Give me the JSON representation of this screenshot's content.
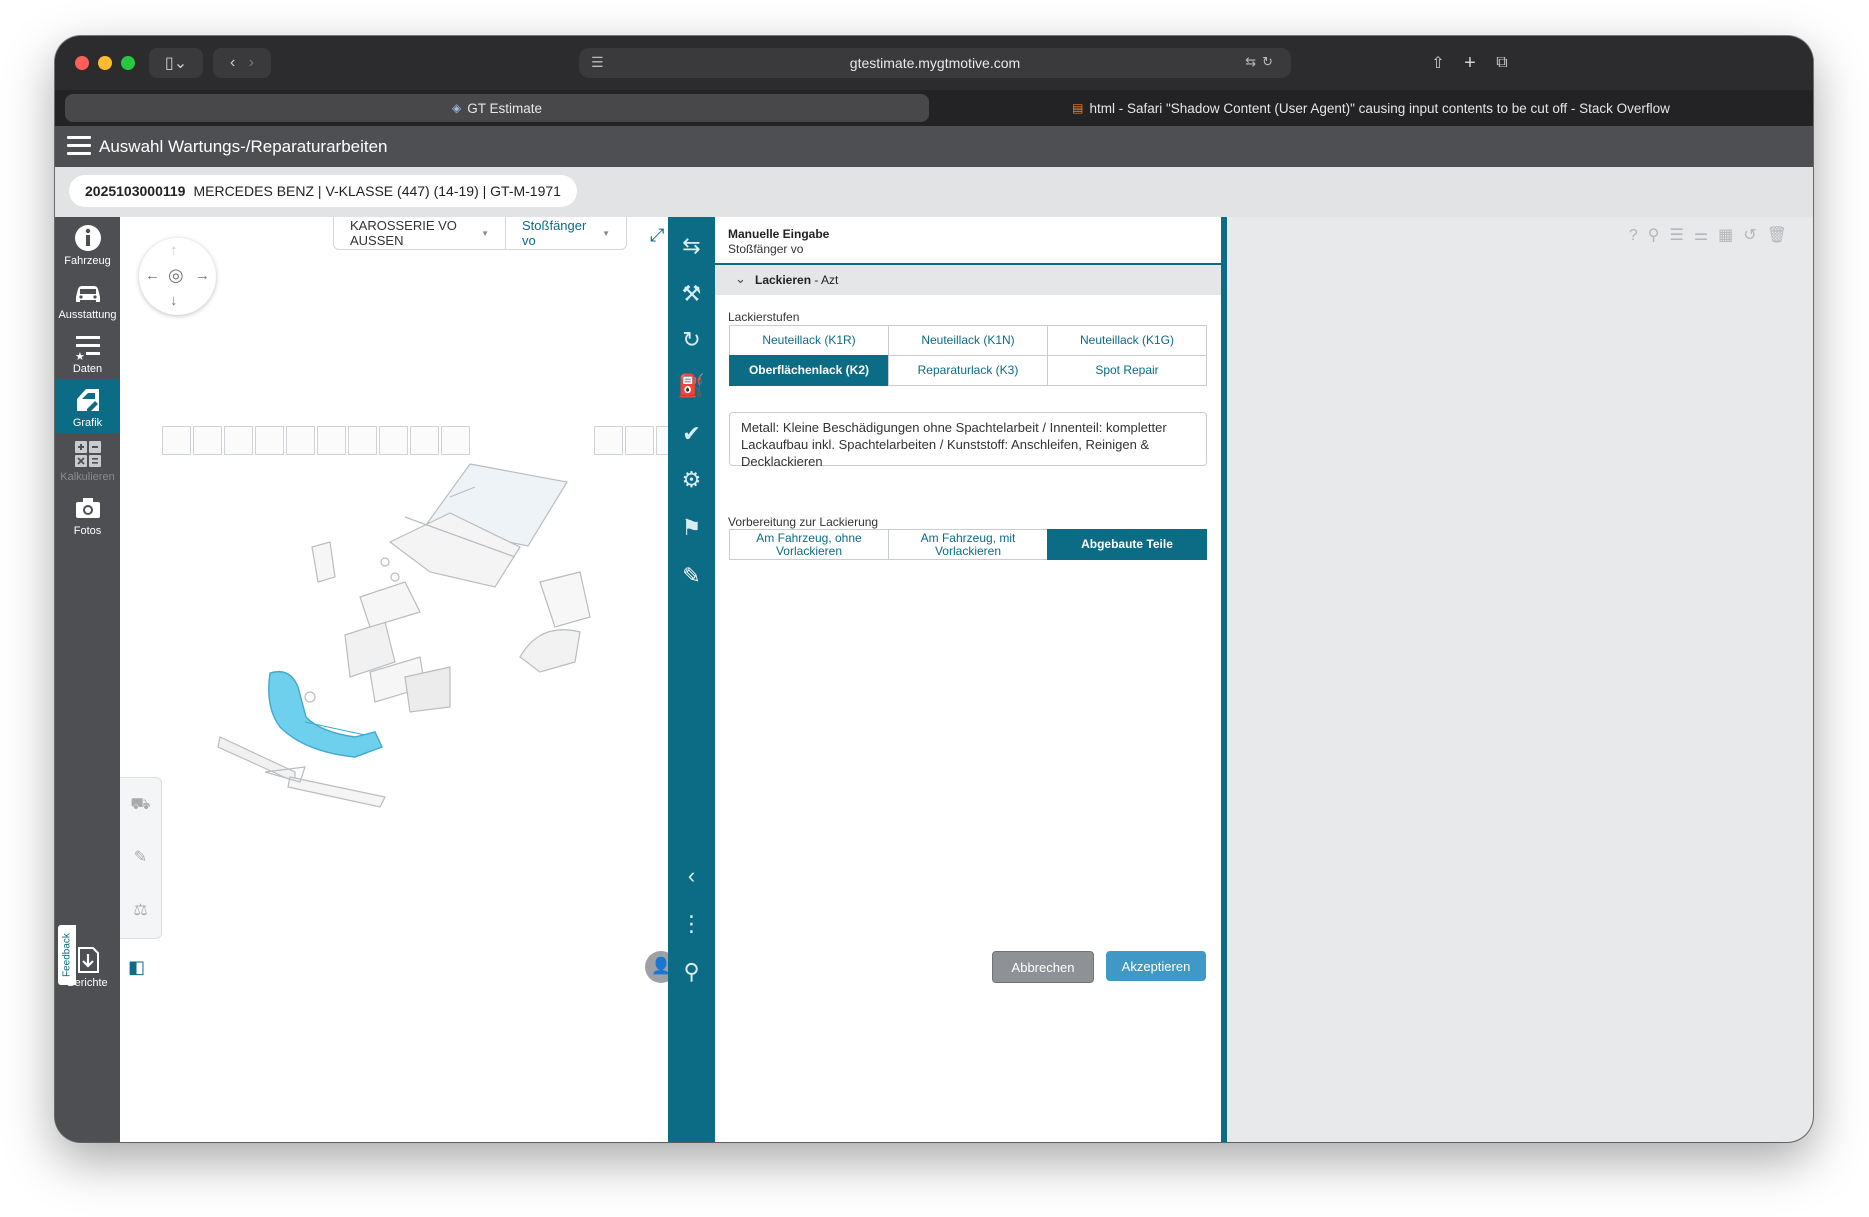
{
  "browser": {
    "url": "gtestimate.mygtmotive.com",
    "tabs": [
      {
        "label": "GT Estimate",
        "favicon": "gt-icon"
      },
      {
        "label": "html - Safari \"Shadow Content (User Agent)\" causing input contents to be cut off - Stack Overflow",
        "favicon": "stackoverflow-icon"
      }
    ]
  },
  "app": {
    "title": "Auswahl Wartungs-/Reparaturarbeiten",
    "vehicle": {
      "id": "2025103000119",
      "desc": "MERCEDES BENZ | V-KLASSE (447) (14-19) | GT-M-1971"
    }
  },
  "leftnav": {
    "items": [
      {
        "label": "Fahrzeug",
        "icon": "info-icon"
      },
      {
        "label": "Ausstattung",
        "icon": "car-icon"
      },
      {
        "label": "Daten",
        "icon": "list-star-icon"
      },
      {
        "label": "Grafik",
        "icon": "door-edit-icon"
      },
      {
        "label": "Kalkulieren",
        "icon": "calculator-icon"
      },
      {
        "label": "Fotos",
        "icon": "camera-icon"
      },
      {
        "label": "Berichte",
        "icon": "report-download-icon"
      }
    ],
    "feedback": "Feedback"
  },
  "graphic": {
    "group_selector": "KAROSSERIE VO AUSSEN",
    "part_selector": "Stoßfänger vo"
  },
  "form": {
    "header_title": "Manuelle Eingabe",
    "header_subtitle": "Stoßfänger vo",
    "section_title": "Lackieren",
    "section_suffix": " - Azt",
    "paint_levels_label": "Lackierstufen",
    "paint_levels": [
      "Neuteillack (K1R)",
      "Neuteillack (K1N)",
      "Neuteillack (K1G)",
      "Oberflächenlack (K2)",
      "Reparaturlack (K3)",
      "Spot Repair"
    ],
    "paint_levels_selected": "Oberflächenlack (K2)",
    "description": "Metall: Kleine Beschädigungen ohne Spachtelarbeit / Innenteil: kompletter Lackaufbau inkl. Spachtelarbeiten / Kunststoff: Anschleifen, Reinigen & Decklackieren",
    "prep_label": "Vorbereitung zur Lackierung",
    "prep_options": [
      "Am Fahrzeug, ohne Vorlackieren",
      "Am Fahrzeug, mit Vorlackieren",
      "Abgebaute Teile"
    ],
    "prep_selected": "Abgebaute Teile",
    "cancel_label": "Abbrechen",
    "accept_label": "Akzeptieren"
  },
  "colors": {
    "accent": "#0c6b85",
    "highlight_part": "#5bc8ea",
    "accept": "#3f98c6"
  }
}
